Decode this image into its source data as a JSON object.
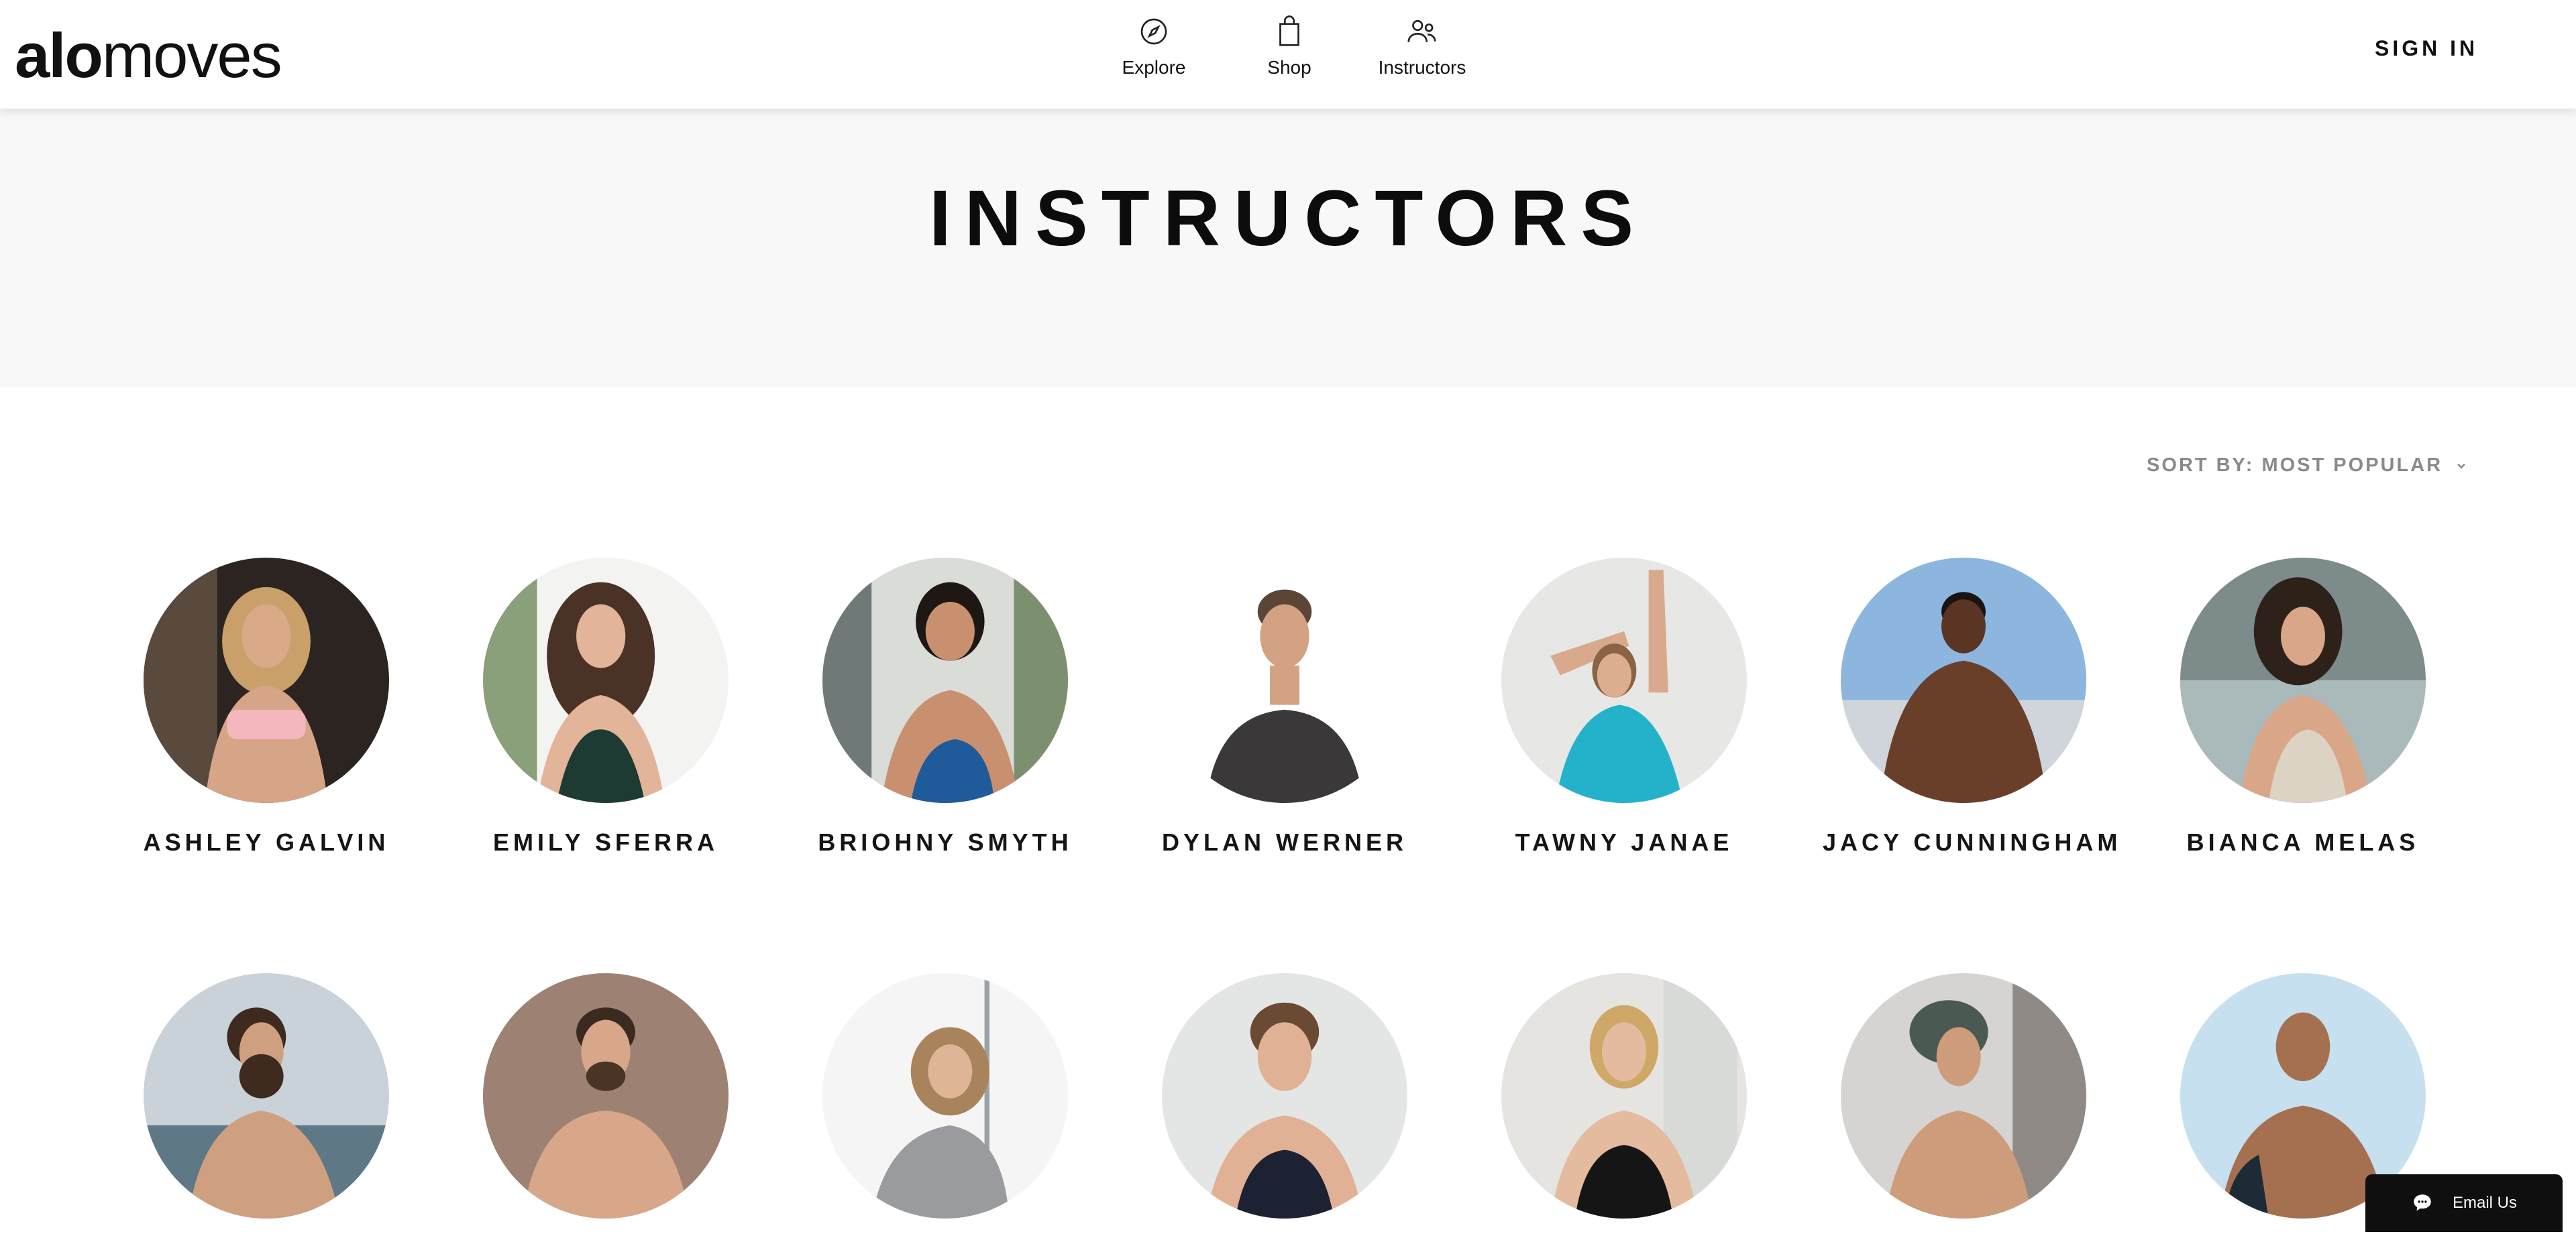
{
  "header": {
    "logo_bold": "alo",
    "logo_light": "moves",
    "nav": [
      {
        "label": "Explore",
        "icon": "compass-icon"
      },
      {
        "label": "Shop",
        "icon": "shopping-bag-icon"
      },
      {
        "label": "Instructors",
        "icon": "people-icon"
      }
    ],
    "sign_in": "SIGN IN"
  },
  "banner": {
    "title": "INSTRUCTORS"
  },
  "sort": {
    "label": "SORT BY: MOST POPULAR",
    "icon": "chevron-down-icon"
  },
  "instructors": [
    {
      "name": "ASHLEY GALVIN"
    },
    {
      "name": "EMILY SFERRA"
    },
    {
      "name": "BRIOHNY SMYTH"
    },
    {
      "name": "DYLAN WERNER"
    },
    {
      "name": "TAWNY JANAE"
    },
    {
      "name": "JACY CUNNINGHAM"
    },
    {
      "name": "BIANCA MELAS"
    },
    {
      "name": ""
    },
    {
      "name": ""
    },
    {
      "name": ""
    },
    {
      "name": ""
    },
    {
      "name": ""
    },
    {
      "name": ""
    },
    {
      "name": ""
    }
  ],
  "email_widget": {
    "label": "Email Us",
    "icon": "chat-bubble-icon"
  },
  "colors": {
    "banner_bg": "#f8f8f8",
    "text": "#111111",
    "sort_text": "#8a8a8a",
    "widget_bg": "#0f0f0f"
  }
}
